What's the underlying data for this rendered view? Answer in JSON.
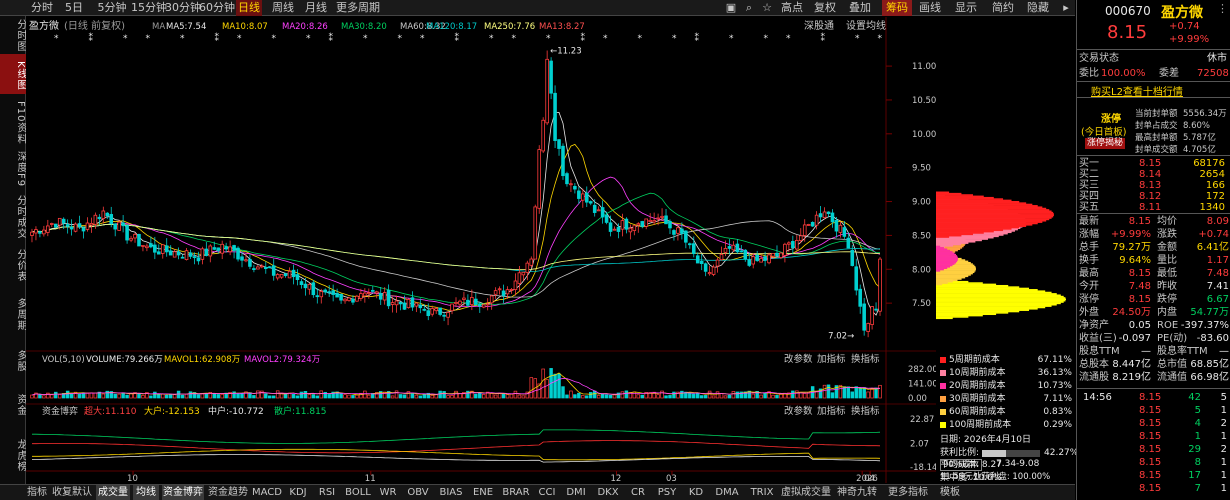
{
  "topbar": {
    "periods": [
      "分时",
      "5日",
      "5分钟",
      "15分钟",
      "30分钟",
      "60分钟",
      "日线",
      "周线",
      "月线",
      "更多周期"
    ],
    "active_period": "日线",
    "right_buttons": [
      "高点",
      "复权",
      "叠加",
      "筹码",
      "画线",
      "显示",
      "简约",
      "隐藏"
    ]
  },
  "leftnav": [
    "分时图",
    "K线图",
    "F10资料",
    "深度F9",
    "分时成交",
    "分价表",
    "多周期",
    "多股",
    "资金",
    "龙虎榜"
  ],
  "leftnav_selected": "K线图",
  "chart_header": {
    "name": "盈方微",
    "mode": "(日线 前复权)",
    "ma_label": "MA",
    "ma5": "MA5:7.54",
    "ma10": "MA10:8.07",
    "ma20": "MA20:8.26",
    "ma30": "MA30:8.20",
    "ma60": "MA60:8.32",
    "ma120": "MA120:8.17",
    "ma250": "MA250:7.76",
    "ma13": "MA13:8.27",
    "deep": "深股通",
    "setting": "设置均线"
  },
  "vol_header": {
    "title": "VOL(5,10)",
    "volume": "VOLUME:79.266万",
    "mavol1": "MAVOL1:62.908万",
    "mavol2": "MAVOL2:79.324万",
    "buttons": [
      "改参数",
      "加指标",
      "换指标"
    ]
  },
  "flow_header": {
    "title": "资金博弈",
    "super": "超大:11.110",
    "big": "大户:-12.153",
    "mid": "中户:-10.772",
    "small": "散户:11.815",
    "buttons": [
      "改参数",
      "加指标",
      "换指标"
    ]
  },
  "price_axis": [
    "11.00",
    "10.50",
    "10.00",
    "9.50",
    "9.00",
    "8.50",
    "8.00",
    "7.50"
  ],
  "vol_axis": [
    "282.00",
    "141.00",
    "0.00"
  ],
  "flow_axis": [
    "22.87",
    "2.07",
    "-18.14"
  ],
  "x_axis": [
    "10",
    "11",
    "12",
    "2026",
    "03",
    "04"
  ],
  "annotations": {
    "high": "11.23",
    "low": "7.02"
  },
  "chip": {
    "items": [
      {
        "label": "5周期前成本",
        "value": "67.11%",
        "color": "#ff2020"
      },
      {
        "label": "10周期前成本",
        "value": "36.13%",
        "color": "#ff80a0"
      },
      {
        "label": "20周期前成本",
        "value": "10.73%",
        "color": "#ff30a0"
      },
      {
        "label": "30周期前成本",
        "value": "7.11%",
        "color": "#ffa040"
      },
      {
        "label": "60周期前成本",
        "value": "0.83%",
        "color": "#ffd040"
      },
      {
        "label": "100周期前成本",
        "value": "0.29%",
        "color": "#ffff00"
      }
    ],
    "date": "日期: 2026年4月10日",
    "profit_label": "获利比例:",
    "profit_value": "42.27%",
    "avg_cost": "平均成本: 8.27",
    "profit_line": "11.59元处获利盘: 100.00%",
    "cost_select": "90%成本",
    "cost_range": "7.34-9.08",
    "concentration": "集中度: 10.6%"
  },
  "stock": {
    "code": "000670",
    "name": "盈方微",
    "price": "8.15",
    "change": "+0.74",
    "pct": "+9.99%",
    "status_label": "交易状态",
    "status": "休市",
    "weibi_label": "委比",
    "weibi": "100.00%",
    "weicha_label": "委差",
    "weicha": "72508",
    "l2_button": "购买L2查看十档行情",
    "limit_title": "涨停",
    "limit_sub": "(今日首板)",
    "limit_btn": "涨停揭秘",
    "limit_info": [
      {
        "k": "当前封单额",
        "v": "5556.34万"
      },
      {
        "k": "封单占成交",
        "v": "8.60%"
      },
      {
        "k": "最高封单额",
        "v": "5.787亿"
      },
      {
        "k": "封单成交额",
        "v": "4.705亿"
      }
    ],
    "asks": [
      [
        "卖一",
        "",
        ""
      ],
      [
        "卖二",
        "",
        ""
      ],
      [
        "卖三",
        "",
        ""
      ],
      [
        "卖四",
        "",
        ""
      ],
      [
        "卖五",
        "",
        ""
      ]
    ],
    "bids": [
      [
        "买一",
        "8.15",
        "68176"
      ],
      [
        "买二",
        "8.14",
        "2654"
      ],
      [
        "买三",
        "8.13",
        "166"
      ],
      [
        "买四",
        "8.12",
        "172"
      ],
      [
        "买五",
        "8.11",
        "1340"
      ]
    ],
    "quote": [
      [
        {
          "k": "最新",
          "v": "8.15",
          "c": "red"
        },
        {
          "k": "均价",
          "v": "8.09",
          "c": "red"
        }
      ],
      [
        {
          "k": "涨幅",
          "v": "+9.99%",
          "c": "red"
        },
        {
          "k": "涨跌",
          "v": "+0.74",
          "c": "red"
        }
      ],
      [
        {
          "k": "总手",
          "v": "79.27万",
          "c": "yellow"
        },
        {
          "k": "金额",
          "v": "6.41亿",
          "c": "yellow"
        }
      ],
      [
        {
          "k": "换手",
          "v": "9.64%",
          "c": "yellow"
        },
        {
          "k": "量比",
          "v": "1.17",
          "c": "red"
        }
      ],
      [
        {
          "k": "最高",
          "v": "8.15",
          "c": "red"
        },
        {
          "k": "最低",
          "v": "7.48",
          "c": "red"
        }
      ],
      [
        {
          "k": "今开",
          "v": "7.48",
          "c": "red"
        },
        {
          "k": "昨收",
          "v": "7.41",
          "c": "white"
        }
      ],
      [
        {
          "k": "涨停",
          "v": "8.15",
          "c": "red"
        },
        {
          "k": "跌停",
          "v": "6.67",
          "c": "green"
        }
      ],
      [
        {
          "k": "外盘",
          "v": "24.50万",
          "c": "red"
        },
        {
          "k": "内盘",
          "v": "54.77万",
          "c": "green"
        }
      ],
      [
        {
          "k": "净资产",
          "v": "0.05",
          "c": "white"
        },
        {
          "k": "ROE",
          "v": "-397.37%",
          "c": "white"
        }
      ],
      [
        {
          "k": "收益(三)",
          "v": "-0.097",
          "c": "white"
        },
        {
          "k": "PE(动)",
          "v": "-83.60",
          "c": "white"
        }
      ],
      [
        {
          "k": "股息TTM",
          "v": "—",
          "c": "white"
        },
        {
          "k": "股息率TTM",
          "v": "—",
          "c": "white"
        }
      ],
      [
        {
          "k": "总股本",
          "v": "8.447亿",
          "c": "white"
        },
        {
          "k": "总市值",
          "v": "68.85亿",
          "c": "white"
        }
      ],
      [
        {
          "k": "流通股",
          "v": "8.219亿",
          "c": "white"
        },
        {
          "k": "流通值",
          "v": "66.98亿",
          "c": "white"
        }
      ]
    ],
    "ticks": [
      {
        "t": "14:56",
        "p": "8.15",
        "v": "42",
        "n": "5"
      },
      {
        "t": "",
        "p": "8.15",
        "v": "5",
        "n": "1"
      },
      {
        "t": "",
        "p": "8.15",
        "v": "4",
        "n": "2"
      },
      {
        "t": "",
        "p": "8.15",
        "v": "1",
        "n": "1"
      },
      {
        "t": "",
        "p": "8.15",
        "v": "29",
        "n": "2"
      },
      {
        "t": "",
        "p": "8.15",
        "v": "8",
        "n": "1"
      },
      {
        "t": "",
        "p": "8.15",
        "v": "17",
        "n": "1"
      },
      {
        "t": "",
        "p": "8.15",
        "v": "7",
        "n": "1"
      }
    ]
  },
  "bottombar": [
    "指标",
    "收复默认",
    "成交量",
    "均线",
    "资金博弈",
    "资金趋势",
    "MACD",
    "KDJ",
    "RSI",
    "BOLL",
    "WR",
    "OBV",
    "BIAS",
    "ENE",
    "BRAR",
    "CCI",
    "DMI",
    "DKX",
    "CR",
    "PSY",
    "KD",
    "DMA",
    "TRIX",
    "虚拟成交量",
    "神奇九转",
    "更多指标",
    "模板"
  ],
  "bottombar_selected": [
    "成交量",
    "均线",
    "资金博弈"
  ],
  "chart_data": {
    "type": "candlestick",
    "price_range": [
      7.0,
      11.4
    ],
    "vol_range": [
      0,
      282
    ],
    "flow_range": [
      -18.14,
      22.87
    ],
    "anchors": [
      [
        0,
        8.55
      ],
      [
        6,
        8.7
      ],
      [
        12,
        8.6
      ],
      [
        18,
        8.85
      ],
      [
        24,
        8.5
      ],
      [
        30,
        8.3
      ],
      [
        36,
        8.25
      ],
      [
        42,
        8.2
      ],
      [
        48,
        8.35
      ],
      [
        54,
        8.15
      ],
      [
        60,
        7.95
      ],
      [
        66,
        7.9
      ],
      [
        72,
        7.65
      ],
      [
        78,
        7.5
      ],
      [
        84,
        7.7
      ],
      [
        90,
        7.55
      ],
      [
        96,
        7.45
      ],
      [
        102,
        7.35
      ],
      [
        108,
        7.5
      ],
      [
        114,
        7.55
      ],
      [
        120,
        7.7
      ],
      [
        126,
        8.2
      ],
      [
        130,
        11.23
      ],
      [
        134,
        9.4
      ],
      [
        140,
        9.0
      ],
      [
        146,
        8.6
      ],
      [
        152,
        8.7
      ],
      [
        158,
        8.75
      ],
      [
        164,
        8.5
      ],
      [
        170,
        7.9
      ],
      [
        176,
        8.3
      ],
      [
        182,
        8.1
      ],
      [
        188,
        8.2
      ],
      [
        194,
        8.5
      ],
      [
        200,
        8.9
      ],
      [
        206,
        8.4
      ],
      [
        210,
        7.1
      ],
      [
        213,
        7.41
      ],
      [
        214,
        8.15
      ]
    ],
    "n_bars": 215
  }
}
